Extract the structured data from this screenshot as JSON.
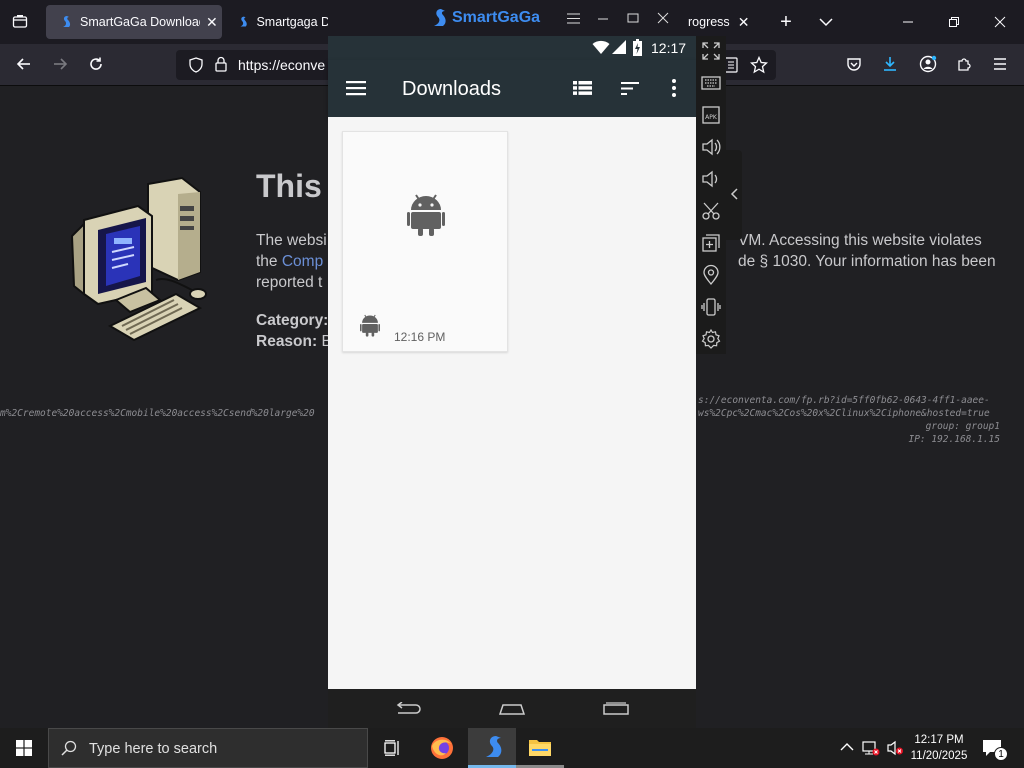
{
  "browser": {
    "tabs": [
      {
        "label": "SmartGaGa Download"
      },
      {
        "label": "Smartgaga Do"
      },
      {
        "label": "rogress"
      }
    ],
    "url": "https://econve",
    "tab_close_glyph": "✕",
    "new_tab_glyph": "+"
  },
  "page": {
    "heading": "This",
    "body_line1_start": "The websi",
    "body_line1_end": "VM. Accessing this website violates",
    "body_line2_link": "Comp",
    "body_line2_prefix": "the ",
    "body_line2_end": "de § 1030. Your information has been",
    "body_line3": "reported t",
    "category_label": "Category:",
    "reason_label": "Reason:",
    "reason_value": "B",
    "query_fragment": "m%2Cremote%20access%2Cmobile%20access%2Csend%20large%20",
    "debug_line1": "s://econventa.com/fp.rb?id=5ff0fb62-0643-4ff1-aaee-",
    "debug_line2": "ws%2Cpc%2Cmac%2Cos%20x%2Clinux%2Ciphone&hosted=true",
    "debug_group": "group: group1",
    "debug_ip": "IP: 192.168.1.15"
  },
  "emulator": {
    "title": "SmartGaGa",
    "status_time": "12:17",
    "app_title": "Downloads",
    "card_time": "12:16 PM"
  },
  "taskbar": {
    "search_placeholder": "Type here to search",
    "time": "12:17 PM",
    "date": "11/20/2025",
    "notification_count": "1"
  },
  "colors": {
    "accent": "#76b9ed",
    "appbar": "#263238",
    "link": "#6b8fd6"
  }
}
